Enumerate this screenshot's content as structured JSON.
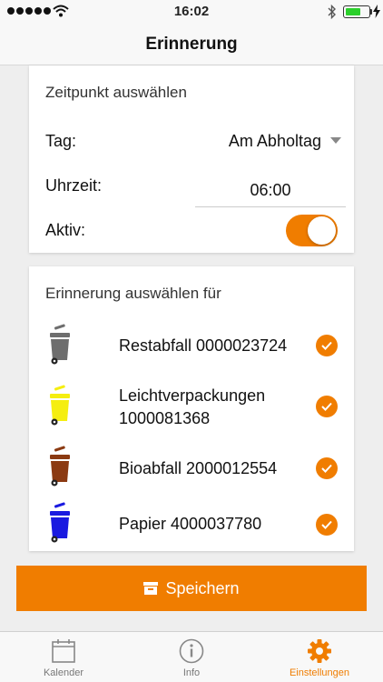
{
  "status_bar": {
    "time": "16:02"
  },
  "header": {
    "title": "Erinnerung"
  },
  "schedule": {
    "title": "Zeitpunkt auswählen",
    "day_label": "Tag:",
    "day_value": "Am Abholtag",
    "time_label": "Uhrzeit:",
    "time_value": "06:00",
    "active_label": "Aktiv:",
    "active": true
  },
  "reminders": {
    "title": "Erinnerung auswählen für",
    "items": [
      {
        "line1": "Restabfall 0000023724",
        "line2": "",
        "color": "#6e6e6e",
        "checked": true
      },
      {
        "line1": "Leichtverpackungen",
        "line2": "1000081368",
        "color": "#f5ee10",
        "checked": true
      },
      {
        "line1": "Bioabfall 2000012554",
        "line2": "",
        "color": "#8b3a12",
        "checked": true
      },
      {
        "line1": "Papier 4000037780",
        "line2": "",
        "color": "#1a1ae0",
        "checked": true
      }
    ]
  },
  "save_button": {
    "label": "Speichern"
  },
  "tabs": [
    {
      "label": "Kalender",
      "icon": "calendar-icon",
      "active": false
    },
    {
      "label": "Info",
      "icon": "info-icon",
      "active": false
    },
    {
      "label": "Einstellungen",
      "icon": "gear-icon",
      "active": true
    }
  ],
  "colors": {
    "accent": "#f07d00"
  }
}
